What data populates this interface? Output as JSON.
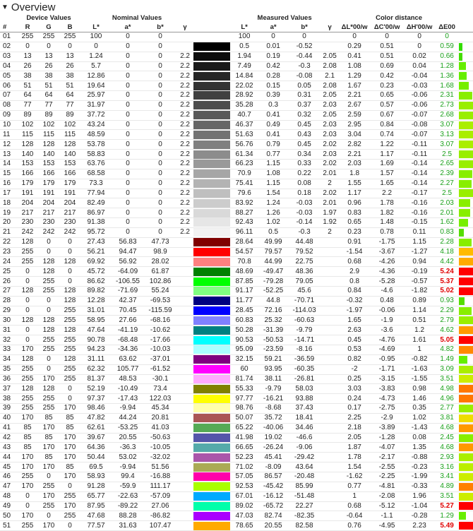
{
  "title": "Overview",
  "headers": {
    "groups": [
      "Device Values",
      "Nominal Values",
      "Measured Values",
      "Color distance"
    ],
    "cols": [
      "#",
      "R",
      "G",
      "B",
      "L*",
      "a*",
      "b*",
      "γ",
      "",
      "L*",
      "a*",
      "b*",
      "γ",
      "ΔL*00/w",
      "ΔC'00/w",
      "ΔH'00/w",
      "ΔE00",
      ""
    ]
  },
  "rows": [
    [
      "01",
      "255",
      "255",
      "255",
      "100",
      "0",
      "0",
      "",
      "#ffffff",
      "100",
      "0",
      "0",
      "",
      "0",
      "0",
      "0",
      "0",
      "#ffffff",
      0
    ],
    [
      "02",
      "0",
      "0",
      "0",
      "0",
      "0",
      "0",
      "",
      "#000000",
      "0.5",
      "0.01",
      "-0.52",
      "",
      "0.29",
      "0.51",
      "0",
      "0.59",
      "#33dd00",
      0.59
    ],
    [
      "03",
      "13",
      "13",
      "13",
      "1.24",
      "0",
      "0",
      "2.2",
      "#0d0d0d",
      "1.94",
      "0.19",
      "-0.44",
      "2.05",
      "0.41",
      "0.51",
      "0.02",
      "0.66",
      "#44dd00",
      0.66
    ],
    [
      "04",
      "26",
      "26",
      "26",
      "5.7",
      "0",
      "0",
      "2.2",
      "#1a1a1a",
      "7.49",
      "0.42",
      "-0.3",
      "2.08",
      "1.08",
      "0.69",
      "0.04",
      "1.28",
      "#66ee00",
      1.28
    ],
    [
      "05",
      "38",
      "38",
      "38",
      "12.86",
      "0",
      "0",
      "2.2",
      "#262626",
      "14.84",
      "0.28",
      "-0.08",
      "2.1",
      "1.29",
      "0.42",
      "-0.04",
      "1.36",
      "#66ee00",
      1.36
    ],
    [
      "06",
      "51",
      "51",
      "51",
      "19.64",
      "0",
      "0",
      "2.2",
      "#333333",
      "22.02",
      "0.15",
      "0.05",
      "2.08",
      "1.67",
      "0.23",
      "-0.03",
      "1.68",
      "#77ee00",
      1.68
    ],
    [
      "07",
      "64",
      "64",
      "64",
      "25.97",
      "0",
      "0",
      "2.2",
      "#404040",
      "28.92",
      "0.39",
      "0.31",
      "2.05",
      "2.21",
      "0.65",
      "-0.06",
      "2.31",
      "#88ee00",
      2.31
    ],
    [
      "08",
      "77",
      "77",
      "77",
      "31.97",
      "0",
      "0",
      "2.2",
      "#4d4d4d",
      "35.28",
      "0.3",
      "0.37",
      "2.03",
      "2.67",
      "0.57",
      "-0.06",
      "2.73",
      "#99ee00",
      2.73
    ],
    [
      "09",
      "89",
      "89",
      "89",
      "37.72",
      "0",
      "0",
      "2.2",
      "#595959",
      "40.7",
      "0.41",
      "0.32",
      "2.05",
      "2.59",
      "0.67",
      "-0.07",
      "2.68",
      "#99ee00",
      2.68
    ],
    [
      "10",
      "102",
      "102",
      "102",
      "43.24",
      "0",
      "0",
      "2.2",
      "#666666",
      "46.37",
      "0.49",
      "0.45",
      "2.03",
      "2.95",
      "0.84",
      "-0.08",
      "3.07",
      "#aaee00",
      3.07
    ],
    [
      "11",
      "115",
      "115",
      "115",
      "48.59",
      "0",
      "0",
      "2.2",
      "#737373",
      "51.63",
      "0.41",
      "0.43",
      "2.03",
      "3.04",
      "0.74",
      "-0.07",
      "3.13",
      "#aaee00",
      3.13
    ],
    [
      "12",
      "128",
      "128",
      "128",
      "53.78",
      "0",
      "0",
      "2.2",
      "#808080",
      "56.76",
      "0.79",
      "0.45",
      "2.02",
      "2.82",
      "1.22",
      "-0.11",
      "3.07",
      "#aaee00",
      3.07
    ],
    [
      "13",
      "140",
      "140",
      "140",
      "58.83",
      "0",
      "0",
      "2.2",
      "#8c8c8c",
      "61.34",
      "0.77",
      "0.34",
      "2.03",
      "2.21",
      "1.17",
      "-0.11",
      "2.5",
      "#99ee00",
      2.5
    ],
    [
      "14",
      "153",
      "153",
      "153",
      "63.76",
      "0",
      "0",
      "2.2",
      "#999999",
      "66.23",
      "1.15",
      "0.33",
      "2.02",
      "2.03",
      "1.69",
      "-0.14",
      "2.65",
      "#99ee00",
      2.65
    ],
    [
      "15",
      "166",
      "166",
      "166",
      "68.58",
      "0",
      "0",
      "2.2",
      "#a6a6a6",
      "70.9",
      "1.08",
      "0.22",
      "2.01",
      "1.8",
      "1.57",
      "-0.14",
      "2.39",
      "#88ee00",
      2.39
    ],
    [
      "16",
      "179",
      "179",
      "179",
      "73.3",
      "0",
      "0",
      "2.2",
      "#b3b3b3",
      "75.41",
      "1.15",
      "0.08",
      "2",
      "1.55",
      "1.65",
      "-0.14",
      "2.27",
      "#88ee00",
      2.27
    ],
    [
      "17",
      "191",
      "191",
      "191",
      "77.94",
      "0",
      "0",
      "2.2",
      "#bfbfbf",
      "79.6",
      "1.54",
      "0.18",
      "2.02",
      "1.17",
      "2.2",
      "-0.17",
      "2.5",
      "#99ee00",
      2.5
    ],
    [
      "18",
      "204",
      "204",
      "204",
      "82.49",
      "0",
      "0",
      "2.2",
      "#cccccc",
      "83.92",
      "1.24",
      "-0.03",
      "2.01",
      "0.96",
      "1.78",
      "-0.16",
      "2.03",
      "#88ee00",
      2.03
    ],
    [
      "19",
      "217",
      "217",
      "217",
      "86.97",
      "0",
      "0",
      "2.2",
      "#d9d9d9",
      "88.27",
      "1.26",
      "-0.03",
      "1.97",
      "0.83",
      "1.82",
      "-0.16",
      "2.01",
      "#88ee00",
      2.01
    ],
    [
      "20",
      "230",
      "230",
      "230",
      "91.38",
      "0",
      "0",
      "2.2",
      "#e6e6e6",
      "92.43",
      "1.02",
      "-0.14",
      "1.92",
      "0.65",
      "1.48",
      "-0.15",
      "1.62",
      "#77ee00",
      1.62
    ],
    [
      "21",
      "242",
      "242",
      "242",
      "95.72",
      "0",
      "0",
      "2.2",
      "#f2f2f2",
      "96.11",
      "0.5",
      "-0.3",
      "2",
      "0.23",
      "0.78",
      "0.11",
      "0.83",
      "#55dd00",
      0.83
    ],
    [
      "22",
      "128",
      "0",
      "0",
      "27.43",
      "56.83",
      "47.73",
      "",
      "#800000",
      "28.64",
      "49.99",
      "44.48",
      "",
      "0.91",
      "-1.75",
      "1.15",
      "2.28",
      "#88ee00",
      2.28
    ],
    [
      "23",
      "255",
      "0",
      "0",
      "56.21",
      "94.47",
      "98.9",
      "",
      "#ff0000",
      "54.57",
      "79.57",
      "79.52",
      "",
      "-1.54",
      "-3.67",
      "-1.27",
      "4.18",
      "#ffbb00",
      4.18
    ],
    [
      "24",
      "255",
      "128",
      "128",
      "69.92",
      "56.92",
      "28.02",
      "",
      "#ff8080",
      "70.8",
      "44.99",
      "22.75",
      "",
      "0.68",
      "-4.26",
      "0.94",
      "4.42",
      "#ffaa00",
      4.42
    ],
    [
      "25",
      "0",
      "128",
      "0",
      "45.72",
      "-64.09",
      "61.87",
      "",
      "#008000",
      "48.69",
      "-49.47",
      "48.36",
      "",
      "2.9",
      "-4.36",
      "-0.19",
      "5.24",
      "#ff0000",
      5.24
    ],
    [
      "26",
      "0",
      "255",
      "0",
      "86.62",
      "-106.55",
      "102.86",
      "",
      "#00ff00",
      "87.85",
      "-79.28",
      "79.05",
      "",
      "0.8",
      "-5.28",
      "-0.57",
      "5.37",
      "#ff0000",
      5.37
    ],
    [
      "27",
      "128",
      "255",
      "128",
      "89.82",
      "-71.69",
      "55.24",
      "",
      "#80ff80",
      "91.17",
      "-52.25",
      "45.6",
      "",
      "0.84",
      "-4.6",
      "-1.82",
      "5.02",
      "#ff0000",
      5.02
    ],
    [
      "28",
      "0",
      "0",
      "128",
      "12.28",
      "42.37",
      "-69.53",
      "",
      "#000080",
      "11.77",
      "44.8",
      "-70.71",
      "",
      "-0.32",
      "0.48",
      "0.89",
      "0.93",
      "#55dd00",
      0.93
    ],
    [
      "29",
      "0",
      "0",
      "255",
      "31.01",
      "70.45",
      "-115.59",
      "",
      "#0000ff",
      "28.45",
      "72.16",
      "-114.03",
      "",
      "-1.97",
      "-0.06",
      "1.14",
      "2.29",
      "#88ee00",
      2.29
    ],
    [
      "30",
      "128",
      "128",
      "255",
      "58.95",
      "27.66",
      "-68.16",
      "",
      "#8080ff",
      "60.83",
      "25.32",
      "-60.63",
      "",
      "1.65",
      "-1.9",
      "0.51",
      "2.79",
      "#99ee00",
      2.79
    ],
    [
      "31",
      "0",
      "128",
      "128",
      "47.64",
      "-41.19",
      "-10.62",
      "",
      "#008080",
      "50.28",
      "-31.39",
      "-9.79",
      "",
      "2.63",
      "-3.6",
      "1.2",
      "4.62",
      "#ff9900",
      4.62
    ],
    [
      "32",
      "0",
      "255",
      "255",
      "90.78",
      "-68.48",
      "-17.66",
      "",
      "#00ffff",
      "90.53",
      "-50.53",
      "-14.71",
      "",
      "0.45",
      "-4.76",
      "1.61",
      "5.05",
      "#ff0000",
      5.05
    ],
    [
      "33",
      "170",
      "255",
      "255",
      "94.23",
      "-34.36",
      "-10.03",
      "",
      "#aaffff",
      "95.09",
      "-23.59",
      "-8.16",
      "",
      "0.53",
      "-4.69",
      "1",
      "4.82",
      "#ff8800",
      4.82
    ],
    [
      "34",
      "128",
      "0",
      "128",
      "31.11",
      "63.62",
      "-37.01",
      "",
      "#800080",
      "32.15",
      "59.21",
      "-36.59",
      "",
      "0.82",
      "-0.95",
      "-0.82",
      "1.49",
      "#66ee00",
      1.49
    ],
    [
      "35",
      "255",
      "0",
      "255",
      "62.32",
      "105.77",
      "-61.52",
      "",
      "#ff00ff",
      "60",
      "93.95",
      "-60.35",
      "",
      "-2",
      "-1.71",
      "-1.63",
      "3.09",
      "#aaee00",
      3.09
    ],
    [
      "36",
      "255",
      "170",
      "255",
      "81.37",
      "48.53",
      "-30.1",
      "",
      "#ffaaff",
      "81.74",
      "38.11",
      "-26.81",
      "",
      "0.25",
      "-3.15",
      "-1.55",
      "3.51",
      "#cced00",
      3.51
    ],
    [
      "37",
      "128",
      "128",
      "0",
      "52.19",
      "-10.49",
      "73.4",
      "",
      "#808000",
      "55.33",
      "-9.79",
      "58.03",
      "",
      "3.03",
      "-3.83",
      "0.98",
      "4.98",
      "#ff7700",
      4.98
    ],
    [
      "38",
      "255",
      "255",
      "0",
      "97.37",
      "-17.43",
      "122.03",
      "",
      "#ffff00",
      "97.77",
      "-16.21",
      "93.88",
      "",
      "0.24",
      "-4.73",
      "1.46",
      "4.96",
      "#ff7700",
      4.96
    ],
    [
      "39",
      "255",
      "255",
      "170",
      "98.46",
      "-9.94",
      "45.34",
      "",
      "#ffffaa",
      "98.76",
      "-8.68",
      "37.43",
      "",
      "0.17",
      "-2.75",
      "0.35",
      "2.77",
      "#99ee00",
      2.77
    ],
    [
      "40",
      "170",
      "85",
      "85",
      "47.82",
      "44.24",
      "20.81",
      "",
      "#aa5555",
      "50.07",
      "35.72",
      "18.41",
      "",
      "2.25",
      "-2.9",
      "1.02",
      "3.81",
      "#eedd00",
      3.81
    ],
    [
      "41",
      "85",
      "170",
      "85",
      "62.61",
      "-53.25",
      "41.03",
      "",
      "#55aa55",
      "65.22",
      "-40.06",
      "34.46",
      "",
      "2.18",
      "-3.89",
      "-1.43",
      "4.68",
      "#ff9900",
      4.68
    ],
    [
      "42",
      "85",
      "85",
      "170",
      "39.67",
      "20.55",
      "-50.63",
      "",
      "#5555aa",
      "41.98",
      "19.02",
      "-46.6",
      "",
      "2.05",
      "-1.28",
      "0.08",
      "2.45",
      "#88ee00",
      2.45
    ],
    [
      "43",
      "85",
      "170",
      "170",
      "64.36",
      "-36.3",
      "-10.05",
      "",
      "#55aaaa",
      "66.65",
      "-26.24",
      "-9.06",
      "",
      "1.87",
      "-4.07",
      "1.35",
      "4.68",
      "#ff9900",
      4.68
    ],
    [
      "44",
      "170",
      "85",
      "170",
      "50.44",
      "53.02",
      "-32.02",
      "",
      "#aa55aa",
      "52.23",
      "45.41",
      "-29.42",
      "",
      "1.78",
      "-2.17",
      "-0.88",
      "2.93",
      "#aaee00",
      2.93
    ],
    [
      "45",
      "170",
      "170",
      "85",
      "69.5",
      "-9.94",
      "51.56",
      "",
      "#aaaa55",
      "71.02",
      "-8.09",
      "43.64",
      "",
      "1.54",
      "-2.55",
      "-0.23",
      "3.16",
      "#bbee00",
      3.16
    ],
    [
      "46",
      "255",
      "0",
      "170",
      "58.93",
      "99.4",
      "-16.88",
      "",
      "#ff00aa",
      "57.05",
      "86.57",
      "-20.48",
      "",
      "-1.62",
      "-2.25",
      "-1.99",
      "3.41",
      "#cced00",
      3.41
    ],
    [
      "47",
      "170",
      "255",
      "0",
      "91.28",
      "-59.9",
      "111.17",
      "",
      "#aaff00",
      "92.53",
      "-45.42",
      "85.99",
      "",
      "0.77",
      "-4.81",
      "-0.33",
      "4.89",
      "#ff8000",
      4.89
    ],
    [
      "48",
      "0",
      "170",
      "255",
      "65.77",
      "-22.63",
      "-57.09",
      "",
      "#00aaff",
      "67.01",
      "-16.12",
      "-51.48",
      "",
      "1",
      "-2.08",
      "1.96",
      "3.51",
      "#cced00",
      3.51
    ],
    [
      "49",
      "0",
      "255",
      "170",
      "87.95",
      "-89.22",
      "27.06",
      "",
      "#00ffaa",
      "89.02",
      "-65.72",
      "22.27",
      "",
      "0.68",
      "-5.12",
      "-1.04",
      "5.27",
      "#ff0000",
      5.27
    ],
    [
      "50",
      "170",
      "0",
      "255",
      "47.68",
      "88.28",
      "-86.82",
      "",
      "#aa00ff",
      "47.03",
      "82.74",
      "-82.35",
      "",
      "-0.64",
      "-1.1",
      "-0.28",
      "1.29",
      "#66ee00",
      1.29
    ],
    [
      "51",
      "255",
      "170",
      "0",
      "77.57",
      "31.63",
      "107.47",
      "",
      "#ffaa00",
      "78.65",
      "20.55",
      "82.58",
      "",
      "0.76",
      "-4.95",
      "2.23",
      "5.49",
      "#ff0000",
      5.49
    ]
  ]
}
